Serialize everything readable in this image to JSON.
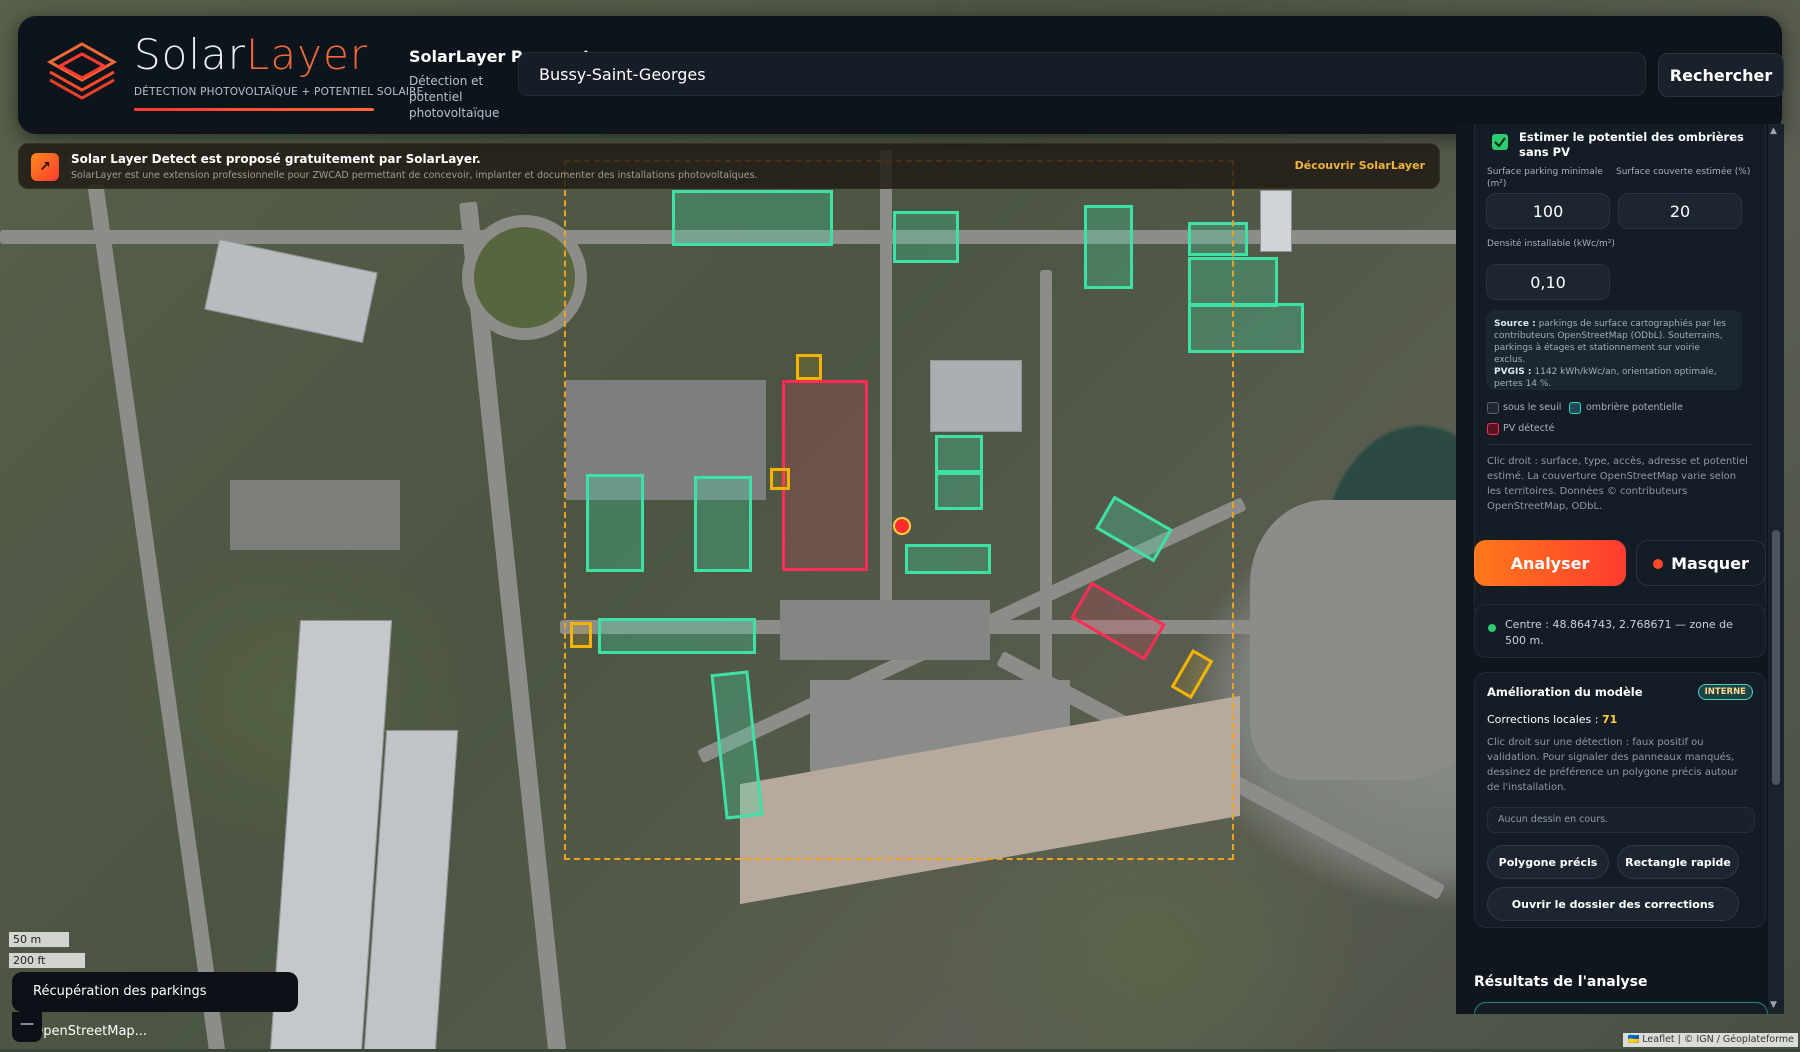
{
  "header": {
    "brand_title_a": "Solar",
    "brand_title_b": "Layer",
    "brand_subtitle": "DÉTECTION PHOTOVOLTAÏQUE + POTENTIEL SOLAIRE",
    "app_name": "SolarLayer Prospect",
    "app_description": "Détection et potentiel photovoltaïque",
    "search_value": "Bussy-Saint-Georges",
    "search_button": "Rechercher"
  },
  "banner": {
    "title": "Solar Layer Detect est proposé gratuitement par SolarLayer.",
    "text": "SolarLayer est une extension professionnelle pour ZWCAD permettant de concevoir, implanter et documenter des installations photovoltaïques.",
    "link": "Découvrir SolarLayer",
    "icon": "arrow-icon"
  },
  "sidebar": {
    "shade_checkbox_label": "Estimer le potentiel des ombrières sans PV",
    "shade_checked": true,
    "min_parking_label": "Surface parking minimale (m²)",
    "min_parking_value": "100",
    "covered_label": "Surface couverte estimée (%)",
    "covered_value": "20",
    "density_label": "Densité installable (kWc/m²)",
    "density_value": "0,10",
    "source_key": "Source :",
    "source_text": "parkings de surface cartographiés par les contributeurs OpenStreetMap (ODbL). Souterrains, parkings à étages et stationnement sur voirie exclus.",
    "pvgis_key": "PVGIS :",
    "pvgis_text": "1142 kWh/kWc/an, orientation optimale, pertes 14 %.",
    "legend": [
      {
        "label": "sous le seuil",
        "color": "#5a6470"
      },
      {
        "label": "ombrière potentielle",
        "color": "#2fd1c0"
      },
      {
        "label": "PV détecté",
        "color": "#ff2d55"
      }
    ],
    "right_click_note": "Clic droit : surface, type, accès, adresse et potentiel estimé. La couverture OpenStreetMap varie selon les territoires. Données © contributeurs OpenStreetMap, ODbL.",
    "analyze_button": "Analyser",
    "hide_button": "Masquer",
    "center_status": "Centre : 48.864743, 2.768671 — zone de 500 m.",
    "model": {
      "title": "Amélioration du modèle",
      "badge": "INTERNE",
      "corrections_label": "Corrections locales :",
      "corrections_value": "71",
      "instructions": "Clic droit sur une détection : faux positif ou validation. Pour signaler des panneaux manqués, dessinez de préférence un polygone précis autour de l'installation.",
      "drawing_status": "Aucun dessin en cours.",
      "polygon_button": "Polygone précis",
      "rectangle_button": "Rectangle rapide",
      "open_folder_button": "Ouvrir le dossier des corrections"
    },
    "results_title": "Résultats de l'analyse"
  },
  "map": {
    "scale_m": "50 m",
    "scale_ft": "200 ft",
    "loading_toast": "Récupération des parkings OpenStreetMap...",
    "collapse_button": "—",
    "attribution": "🇺🇦 Leaflet | © IGN / Géoplateforme",
    "colors": {
      "detected_pv": "#ff2d55",
      "potential": "#3fe0a6",
      "below_threshold": "#f5b400",
      "zone": "#f0a21d"
    }
  }
}
